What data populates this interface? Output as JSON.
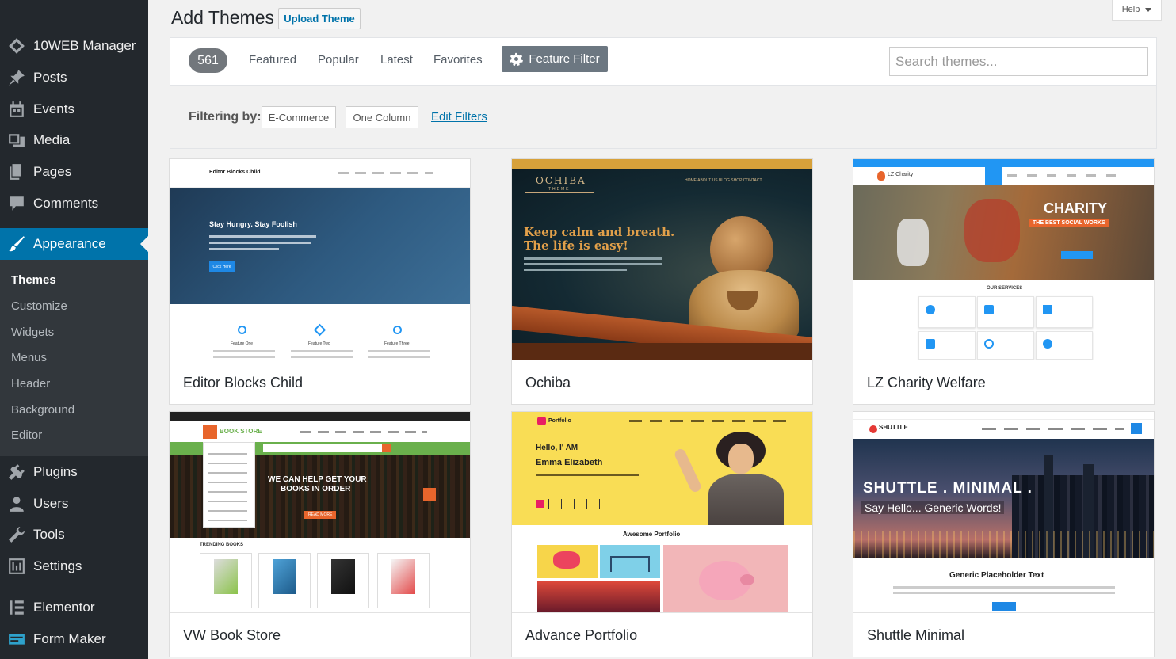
{
  "sidebar": {
    "items": [
      {
        "label": "10WEB Manager",
        "icon": "diamond-icon"
      },
      {
        "label": "Posts",
        "icon": "pin-icon"
      },
      {
        "label": "Events",
        "icon": "calendar-icon"
      },
      {
        "label": "Media",
        "icon": "media-icon"
      },
      {
        "label": "Pages",
        "icon": "pages-icon"
      },
      {
        "label": "Comments",
        "icon": "comment-icon"
      },
      {
        "label": "Appearance",
        "icon": "brush-icon"
      },
      {
        "label": "Plugins",
        "icon": "plug-icon"
      },
      {
        "label": "Users",
        "icon": "user-icon"
      },
      {
        "label": "Tools",
        "icon": "wrench-icon"
      },
      {
        "label": "Settings",
        "icon": "settings-icon"
      },
      {
        "label": "Elementor",
        "icon": "elementor-icon"
      },
      {
        "label": "Form Maker",
        "icon": "form-icon"
      }
    ],
    "submenu": [
      "Themes",
      "Customize",
      "Widgets",
      "Menus",
      "Header",
      "Background",
      "Editor"
    ]
  },
  "header": {
    "title": "Add Themes",
    "upload_label": "Upload Theme",
    "help_label": "Help"
  },
  "filter_bar": {
    "count": "561",
    "links": [
      "Featured",
      "Popular",
      "Latest",
      "Favorites"
    ],
    "feature_filter_label": "Feature Filter",
    "search_placeholder": "Search themes..."
  },
  "filtering": {
    "label": "Filtering by:",
    "tags": [
      "E-Commerce",
      "One Column"
    ],
    "edit_label": "Edit Filters"
  },
  "themes": [
    {
      "name": "Editor Blocks Child",
      "preview": {
        "logo": "Editor Blocks Child",
        "headline": "Stay Hungry. Stay Foolish",
        "button": "Click Here",
        "features": [
          "Feature One",
          "Feature Two",
          "Feature Three"
        ]
      }
    },
    {
      "name": "Ochiba",
      "preview": {
        "logo": "OCHIBA",
        "logo_sub": "THEME",
        "headline_1": "Keep calm and breath.",
        "headline_2": "The life is easy!",
        "nav": "HOME   ABOUT US   BLOG   SHOP   CONTACT"
      }
    },
    {
      "name": "LZ Charity Welfare",
      "preview": {
        "logo": "LZ Charity",
        "hero": "CHARITY",
        "hero_sub": "THE BEST SOCIAL WORKS",
        "section": "OUR SERVICES"
      }
    },
    {
      "name": "VW Book Store",
      "preview": {
        "logo": "BOOK STORE",
        "hero_1": "WE CAN HELP GET YOUR",
        "hero_2": "BOOKS IN ORDER",
        "button": "READ MORE",
        "section": "TRENDING BOOKS"
      }
    },
    {
      "name": "Advance Portfolio",
      "preview": {
        "logo": "Portfolio",
        "hello": "Hello, I' AM",
        "person": "Emma Elizabeth",
        "section": "Awesome Portfolio"
      }
    },
    {
      "name": "Shuttle Minimal",
      "preview": {
        "logo": "SHUTTLE",
        "hero_1": "SHUTTLE . MINIMAL .",
        "hero_2": "Say Hello... Generic Words!",
        "section": "Generic Placeholder Text"
      }
    }
  ],
  "colors": {
    "sidebar_bg": "#23282d",
    "active_blue": "#0073aa",
    "link_blue": "#0073aa"
  }
}
